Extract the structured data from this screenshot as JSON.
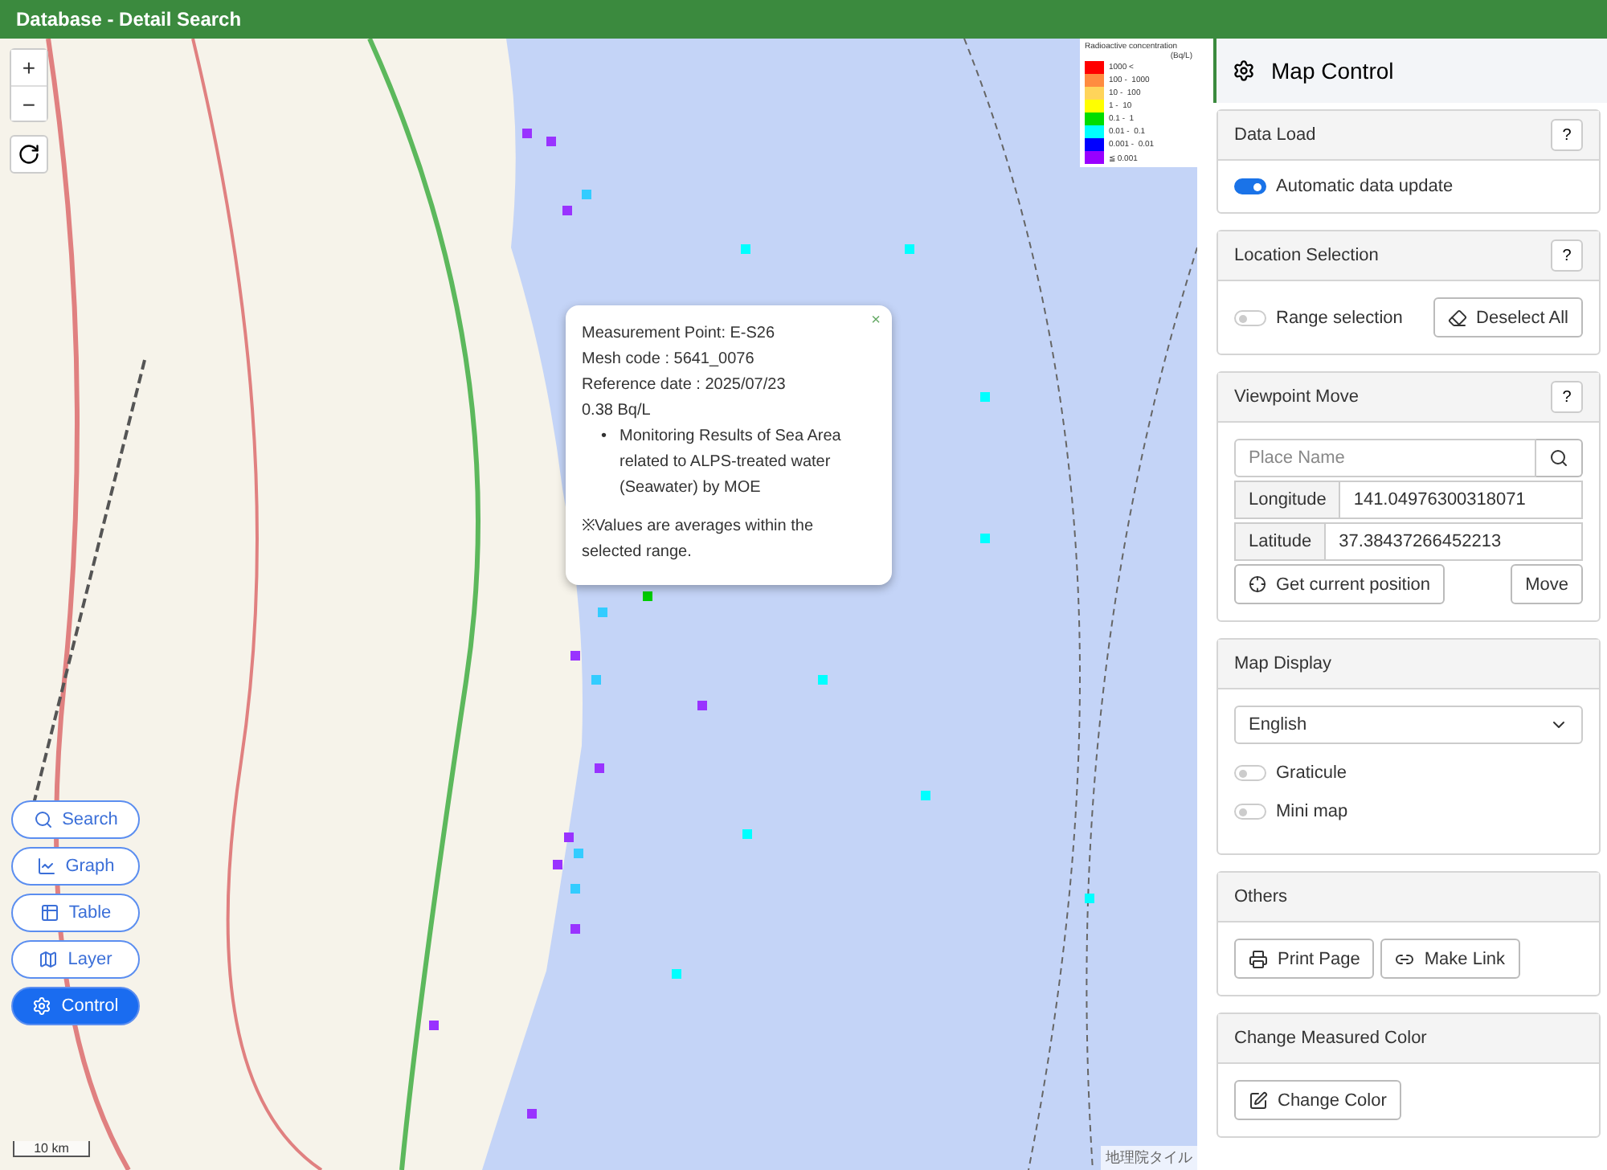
{
  "window": {
    "title": "Database - Detail Search"
  },
  "map_controls": {
    "zoom_in": "+",
    "zoom_out": "−"
  },
  "legend": {
    "title": "Radioactive concentration",
    "unit": "(Bq/L)",
    "items": [
      {
        "label": "1000 <",
        "color": "#ff0000"
      },
      {
        "label": "100 -  1000",
        "color": "#ff8c40"
      },
      {
        "label": "10 -  100",
        "color": "#ffd45a"
      },
      {
        "label": "1 -  10",
        "color": "#ffff00"
      },
      {
        "label": "0.1 -  1",
        "color": "#00dd00"
      },
      {
        "label": "0.01 -  0.1",
        "color": "#00ffff"
      },
      {
        "label": "0.001 -  0.01",
        "color": "#0000ff"
      },
      {
        "label": "≦ 0.001",
        "color": "#9900ff"
      }
    ]
  },
  "popup": {
    "close": "×",
    "lines": [
      "Measurement Point: E-S26",
      "Mesh code : 5641_0076",
      "Reference date : 2025/07/23",
      "0.38 Bq/L"
    ],
    "sources": [
      {
        "bullet": "•",
        "text": "Monitoring Results of Sea Area related to ALPS-treated water (Seawater) by MOE"
      }
    ],
    "note": "※Values are averages within the selected range."
  },
  "side_buttons": [
    {
      "label": "Search",
      "kind": "search",
      "selected": false
    },
    {
      "label": "Graph",
      "kind": "graph",
      "selected": false
    },
    {
      "label": "Table",
      "kind": "table",
      "selected": false
    },
    {
      "label": "Layer",
      "kind": "layer",
      "selected": false
    },
    {
      "label": "Control",
      "kind": "control",
      "selected": true
    }
  ],
  "scale": "10 km",
  "attribution": "地理院タイル",
  "panel": {
    "title": "Map Control",
    "sections": [
      {
        "title": "Data Load",
        "help": "?",
        "kind": "data_load",
        "toggle": {
          "label": "Automatic data update",
          "on": true
        }
      },
      {
        "title": "Location Selection",
        "help": "?",
        "kind": "location",
        "toggle": {
          "label": "Range selection",
          "on": false
        },
        "button": "Deselect All"
      },
      {
        "title": "Viewpoint Move",
        "help": "?",
        "kind": "viewpoint",
        "placeholder": "Place Name",
        "fields": [
          {
            "label": "Longitude",
            "value": "141.04976300318071"
          },
          {
            "label": "Latitude",
            "value": "37.38437266452213"
          }
        ],
        "locate_button": "Get current position",
        "move_button": "Move"
      },
      {
        "title": "Map Display",
        "kind": "display",
        "language": "English",
        "toggles": [
          {
            "label": "Graticule",
            "on": false
          },
          {
            "label": "Mini map",
            "on": false
          }
        ]
      },
      {
        "title": "Others",
        "kind": "others",
        "buttons": [
          {
            "label": "Print Page",
            "kind": "print"
          },
          {
            "label": "Make Link",
            "kind": "link"
          }
        ]
      },
      {
        "title": "Change Measured Color",
        "kind": "color",
        "button": "Change Color"
      }
    ]
  }
}
